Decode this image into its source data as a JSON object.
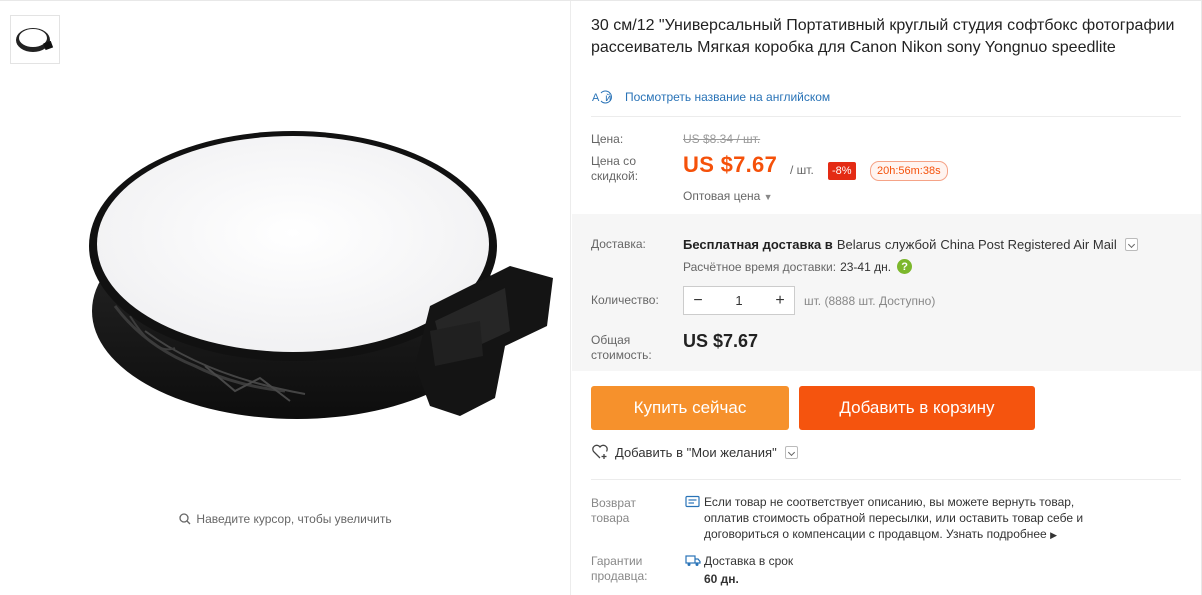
{
  "gallery": {
    "zoom_hint": "Наведите курсор, чтобы увеличить"
  },
  "product": {
    "title": "30 см/12 \"Универсальный Портативный круглый студия софтбокс фотографии рассеиватель Мягкая коробка для Canon Nikon sony Yongnuo speedlite",
    "translate_link": "Посмотреть название на английском"
  },
  "pricing": {
    "price_label": "Цена:",
    "old_price": "US $8.34 / шт.",
    "discount_label_1": "Цена со",
    "discount_label_2": "скидкой:",
    "price": "US $7.67",
    "unit": "/ шт.",
    "discount_badge": "-8%",
    "timer": "20h:56m:38s",
    "wholesale": "Оптовая цена"
  },
  "shipping": {
    "label": "Доставка:",
    "free_prefix": "Бесплатная доставка в",
    "country": "Belarus",
    "service_prefix": "службой",
    "service": "China Post Registered Air Mail",
    "eta_label": "Расчётное время доставки:",
    "eta_value": "23-41 дн."
  },
  "quantity": {
    "label": "Количество:",
    "value": "1",
    "minus": "−",
    "plus": "+",
    "available": "шт. (8888 шт. Доступно)"
  },
  "total": {
    "label_1": "Общая",
    "label_2": "стоимость:",
    "value": "US $7.67"
  },
  "actions": {
    "buy_now": "Купить сейчас",
    "add_to_cart": "Добавить в корзину",
    "wishlist": "Добавить в \"Мои желания\""
  },
  "returns": {
    "label_1": "Возврат",
    "label_2": "товара",
    "line1": "Если товар не соответствует описанию, вы можете вернуть товар,",
    "line2": "оплатив стоимость обратной пересылки, или оставить товар себе и",
    "line3": "договориться о компенсации с продавцом.",
    "more": "Узнать подробнее"
  },
  "guarantee": {
    "label_1": "Гарантии",
    "label_2": "продавца:",
    "line1": "Доставка в срок",
    "line2": "60 дн."
  },
  "colors": {
    "accent_orange": "#f5540e",
    "buy_orange": "#f6912c",
    "price_orange": "#f5510a",
    "link_blue": "#2973b7",
    "discount_red": "#e42b14"
  }
}
